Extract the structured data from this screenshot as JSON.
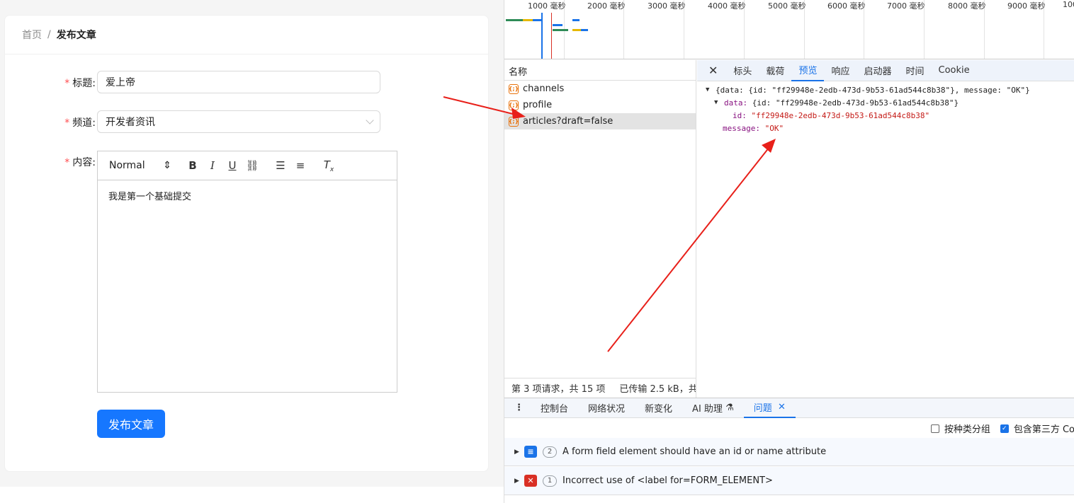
{
  "breadcrumb": {
    "home": "首页",
    "separator": "/",
    "current": "发布文章"
  },
  "form": {
    "required_mark": "*",
    "title_label": "标题:",
    "title_value": "爱上帝",
    "channel_label": "频道:",
    "channel_value": "开发者资讯",
    "content_label": "内容:",
    "editor_format": "Normal",
    "editor_text": "我是第一个基础提交",
    "submit_label": "发布文章"
  },
  "timeline": {
    "ticks": [
      "1000 毫秒",
      "2000 毫秒",
      "3000 毫秒",
      "4000 毫秒",
      "5000 毫秒",
      "6000 毫秒",
      "7000 毫秒",
      "8000 毫秒",
      "9000 毫秒",
      "100"
    ]
  },
  "network": {
    "name_header": "名称",
    "requests": [
      "channels",
      "profile",
      "articles?draft=false"
    ],
    "json_icon": "{;}",
    "footer_count": "第 3 项请求，共 15 项",
    "footer_transfer": "已传输 2.5 kB，共",
    "tabs": [
      "标头",
      "载荷",
      "预览",
      "响应",
      "启动器",
      "时间",
      "Cookie"
    ],
    "active_tab": "预览"
  },
  "preview": {
    "line1": "{data: {id: \"ff29948e-2edb-473d-9b53-61ad544c8b38\"}, message: \"OK\"}",
    "data_key": "data:",
    "data_val": "{id: \"ff29948e-2edb-473d-9b53-61ad544c8b38\"}",
    "id_key": "id:",
    "id_val": "\"ff29948e-2edb-473d-9b53-61ad544c8b38\"",
    "msg_key": "message:",
    "msg_val": "\"OK\""
  },
  "drawer": {
    "tabs": [
      "控制台",
      "网络状况",
      "新变化",
      "AI 助理",
      "问题"
    ],
    "group_label": "按种类分组",
    "third_party_label": "包含第三方 Co"
  },
  "issues": [
    {
      "count": "2",
      "text": "A form field element should have an id or name attribute"
    },
    {
      "count": "1",
      "text": "Incorrect use of <label for=FORM_ELEMENT>"
    }
  ],
  "colors": {
    "primary": "#1677ff",
    "devtools_accent": "#1a73e8",
    "arrow": "#e8201a"
  }
}
